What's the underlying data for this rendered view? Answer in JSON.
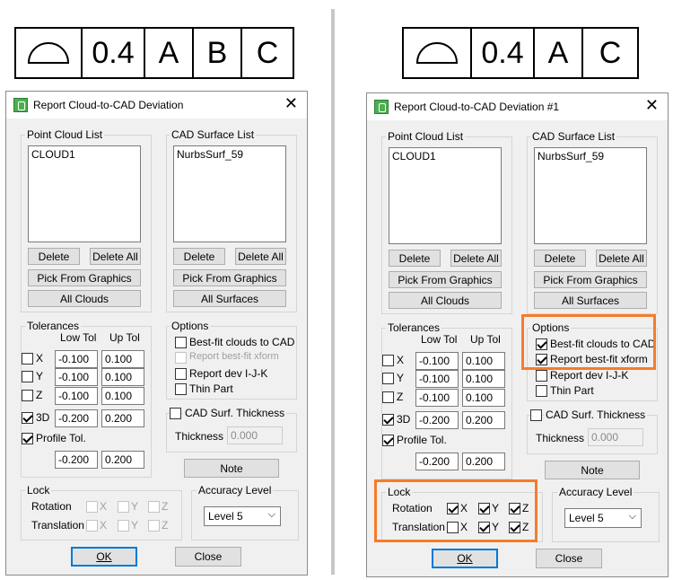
{
  "left_frame": {
    "symbol": "surface-profile-icon",
    "tolerance": "0.4",
    "datums": [
      "A",
      "B",
      "C"
    ]
  },
  "right_frame": {
    "symbol": "surface-profile-icon",
    "tolerance": "0.4",
    "datums": [
      "A",
      "C"
    ]
  },
  "accent": "#f57c2b",
  "dialog_left": {
    "title": "Report Cloud-to-CAD Deviation",
    "point_cloud_list": {
      "label": "Point Cloud List",
      "items": [
        "CLOUD1"
      ]
    },
    "cad_surface_list": {
      "label": "CAD Surface List",
      "items": [
        "NurbsSurf_59"
      ]
    },
    "delete": "Delete",
    "delete_all": "Delete All",
    "pick_from_graphics": "Pick From Graphics",
    "all_clouds": "All Clouds",
    "all_surfaces": "All Surfaces",
    "tolerances": {
      "label": "Tolerances",
      "low_tol": "Low Tol",
      "up_tol": "Up Tol",
      "rows": [
        {
          "axis": "X",
          "low": "-0.100",
          "up": "0.100",
          "checked": false
        },
        {
          "axis": "Y",
          "low": "-0.100",
          "up": "0.100",
          "checked": false
        },
        {
          "axis": "Z",
          "low": "-0.100",
          "up": "0.100",
          "checked": false
        },
        {
          "axis": "3D",
          "low": "-0.200",
          "up": "0.200",
          "checked": true
        }
      ],
      "profile_tol": "Profile Tol.",
      "profile_checked": true,
      "profile_low": "-0.200",
      "profile_up": "0.200"
    },
    "options": {
      "label": "Options",
      "best_fit": "Best-fit clouds to CAD",
      "best_fit_checked": false,
      "report_xform": "Report best-fit xform",
      "report_xform_checked": false,
      "report_xform_disabled": true,
      "report_dev": "Report dev I-J-K",
      "report_dev_checked": false,
      "thin_part": "Thin Part",
      "thin_part_checked": false
    },
    "cad_thickness": {
      "label": "CAD Surf. Thickness",
      "checked": false,
      "thickness_label": "Thickness",
      "value": "0.000"
    },
    "note": "Note",
    "lock": {
      "label": "Lock",
      "rotation": "Rotation",
      "translation": "Translation",
      "rotation_checked": [
        false,
        false,
        false
      ],
      "translation_checked": [
        false,
        false,
        false
      ]
    },
    "axes": [
      "X",
      "Y",
      "Z"
    ],
    "accuracy": {
      "label": "Accuracy Level",
      "value": "Level 5"
    },
    "ok": "OK",
    "close": "Close"
  },
  "dialog_right": {
    "title": "Report Cloud-to-CAD Deviation #1",
    "point_cloud_list": {
      "label": "Point Cloud List",
      "items": [
        "CLOUD1"
      ]
    },
    "cad_surface_list": {
      "label": "CAD Surface List",
      "items": [
        "NurbsSurf_59"
      ]
    },
    "delete": "Delete",
    "delete_all": "Delete All",
    "pick_from_graphics": "Pick From Graphics",
    "all_clouds": "All Clouds",
    "all_surfaces": "All Surfaces",
    "tolerances": {
      "label": "Tolerances",
      "low_tol": "Low Tol",
      "up_tol": "Up Tol",
      "rows": [
        {
          "axis": "X",
          "low": "-0.100",
          "up": "0.100",
          "checked": false
        },
        {
          "axis": "Y",
          "low": "-0.100",
          "up": "0.100",
          "checked": false
        },
        {
          "axis": "Z",
          "low": "-0.100",
          "up": "0.100",
          "checked": false
        },
        {
          "axis": "3D",
          "low": "-0.200",
          "up": "0.200",
          "checked": true
        }
      ],
      "profile_tol": "Profile Tol.",
      "profile_checked": true,
      "profile_low": "-0.200",
      "profile_up": "0.200"
    },
    "options": {
      "label": "Options",
      "best_fit": "Best-fit clouds to CAD",
      "best_fit_checked": true,
      "report_xform": "Report best-fit xform",
      "report_xform_checked": true,
      "report_xform_disabled": false,
      "report_dev": "Report dev I-J-K",
      "report_dev_checked": false,
      "thin_part": "Thin Part",
      "thin_part_checked": false
    },
    "cad_thickness": {
      "label": "CAD Surf. Thickness",
      "checked": false,
      "thickness_label": "Thickness",
      "value": "0.000"
    },
    "note": "Note",
    "lock": {
      "label": "Lock",
      "rotation": "Rotation",
      "translation": "Translation",
      "rotation_checked": [
        true,
        true,
        true
      ],
      "translation_checked": [
        false,
        true,
        true
      ]
    },
    "axes": [
      "X",
      "Y",
      "Z"
    ],
    "accuracy": {
      "label": "Accuracy Level",
      "value": "Level 5"
    },
    "ok": "OK",
    "close": "Close"
  }
}
